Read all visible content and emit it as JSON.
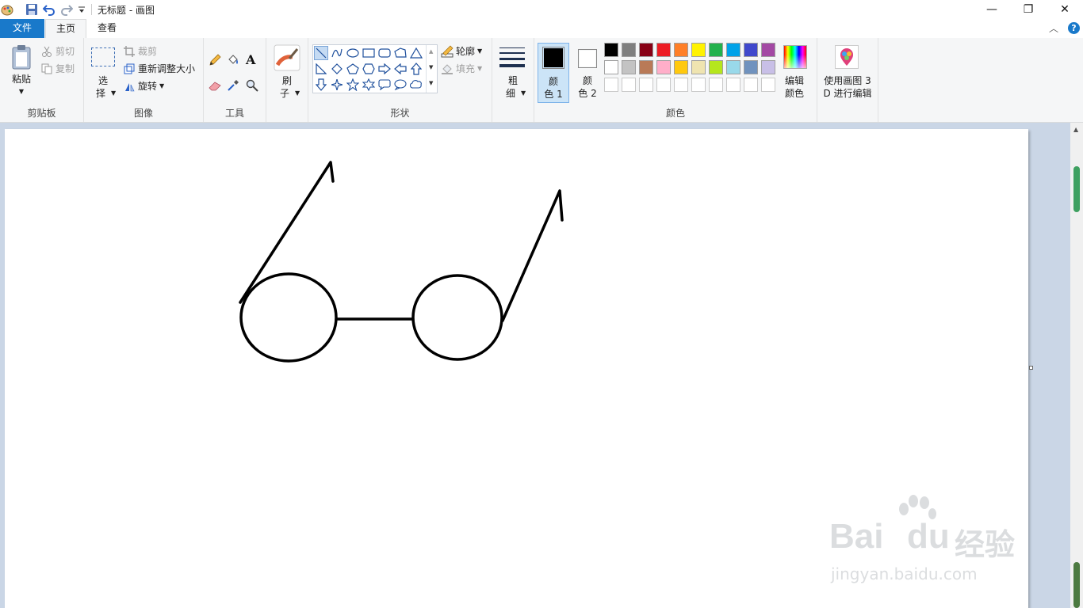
{
  "window": {
    "title": "无标题 - 画图",
    "minimize_glyph": "—",
    "restore_glyph": "❐",
    "close_glyph": "✕"
  },
  "tabs": {
    "file": "文件",
    "home": "主页",
    "view": "查看",
    "collapse_glyph": "︿",
    "help_glyph": "?"
  },
  "clipboard": {
    "paste": "粘贴",
    "cut": "剪切",
    "copy": "复制",
    "group": "剪贴板"
  },
  "image": {
    "select_line1": "选",
    "select_line2": "择",
    "crop": "裁剪",
    "resize": "重新调整大小",
    "rotate": "旋转",
    "group": "图像"
  },
  "tools": {
    "group": "工具",
    "text_glyph": "A"
  },
  "brushes": {
    "line1": "刷",
    "line2": "子"
  },
  "shapes": {
    "outline": "轮廓",
    "fill": "填充",
    "group": "形状"
  },
  "size": {
    "line1": "粗",
    "line2": "细"
  },
  "colors": {
    "color1_line1": "颜",
    "color1_line2": "色 1",
    "color2_line1": "颜",
    "color2_line2": "色 2",
    "color1": "#000000",
    "color2": "#ffffff",
    "edit_line1": "编辑",
    "edit_line2": "颜色",
    "group": "颜色",
    "palette_row1": [
      "#000000",
      "#7f7f7f",
      "#880015",
      "#ed1c24",
      "#ff7f27",
      "#fff200",
      "#22b14c",
      "#00a2e8",
      "#3f48cc",
      "#a349a4"
    ],
    "palette_row2": [
      "#ffffff",
      "#c3c3c3",
      "#b97a57",
      "#ffaec9",
      "#ffc90e",
      "#efe4b0",
      "#b5e61d",
      "#99d9ea",
      "#7092be",
      "#c8bfe7"
    ],
    "palette_row3": [
      "#ffffff",
      "#ffffff",
      "#ffffff",
      "#ffffff",
      "#ffffff",
      "#ffffff",
      "#ffffff",
      "#ffffff",
      "#ffffff",
      "#ffffff"
    ]
  },
  "paint3d": {
    "line1": "使用画图 3",
    "line2": "D 进行编辑"
  },
  "watermark": {
    "brand": "Bai",
    "brand2": "du",
    "cn": "经验",
    "url": "jingyan.baidu.com"
  }
}
